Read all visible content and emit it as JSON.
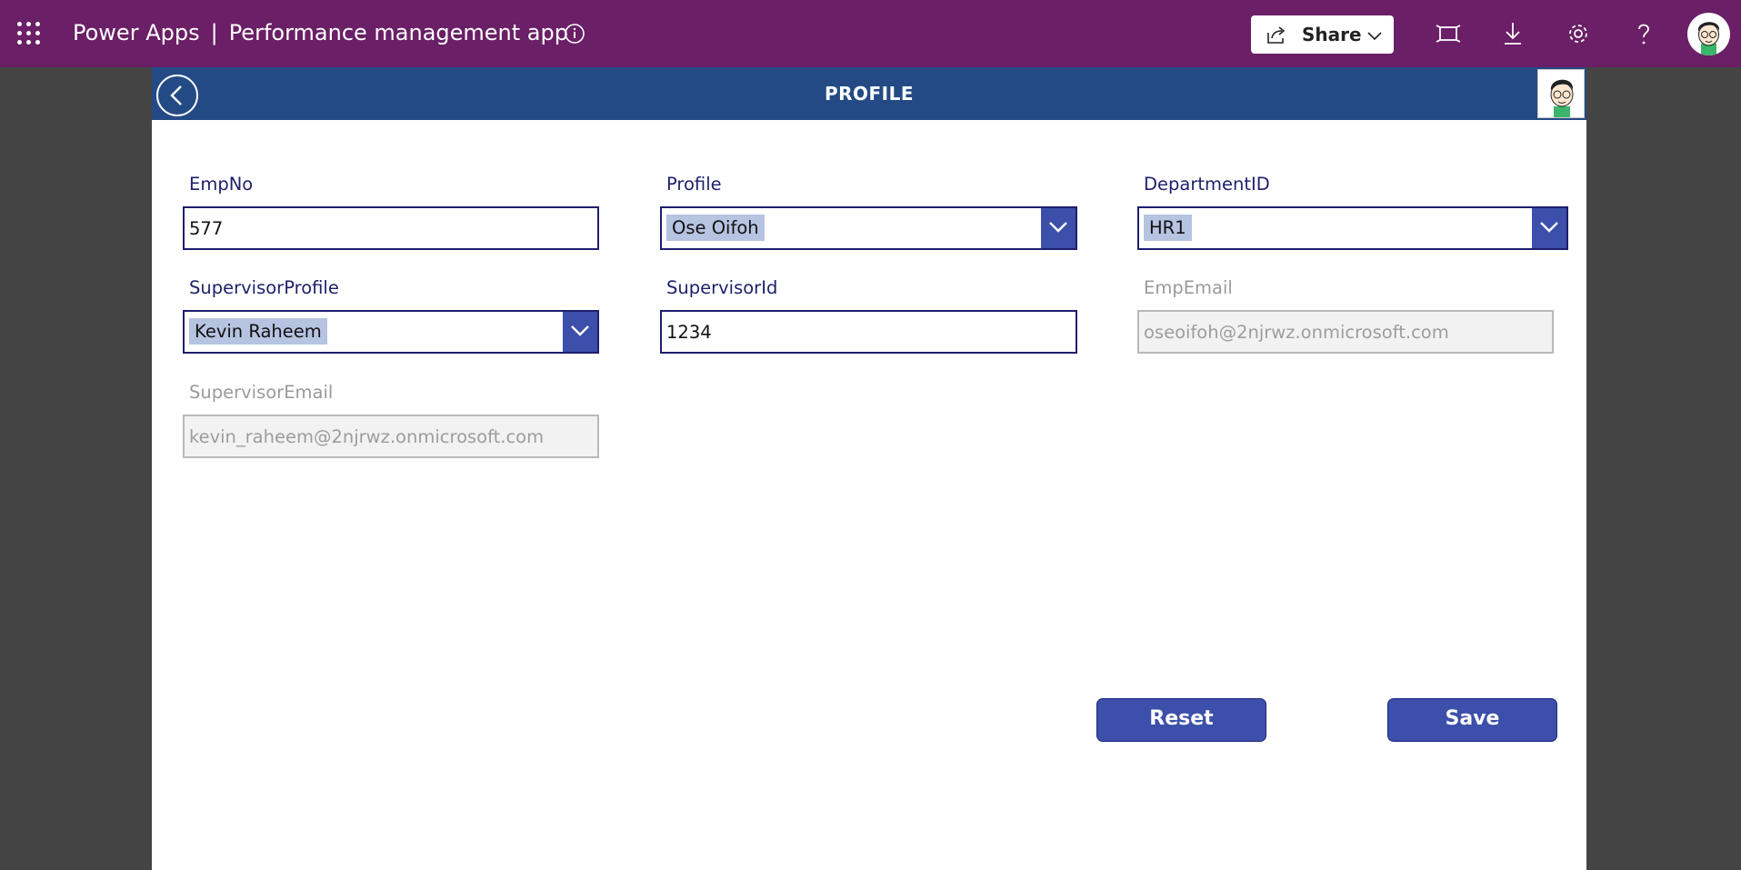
{
  "header": {
    "product": "Power Apps",
    "separator": "|",
    "app_name": "Performance management app",
    "icons": [
      "waffle-icon",
      "info-icon",
      "share-icon",
      "chevron-down-icon",
      "fit-to-screen-icon",
      "download-icon",
      "gear-icon",
      "help-icon",
      "avatar"
    ],
    "share_label": "Share",
    "color": "#6a1f66"
  },
  "app": {
    "title": "PROFILE",
    "header_color": "#234a85",
    "accent": "#3c4faa",
    "form": {
      "empno": {
        "label": "EmpNo",
        "value": "577"
      },
      "profile": {
        "label": "Profile",
        "value": "Ose Oifoh"
      },
      "department_id": {
        "label": "DepartmentID",
        "value": "HR1"
      },
      "supervisor_profile": {
        "label": "SupervisorProfile",
        "value": "Kevin Raheem"
      },
      "supervisor_id": {
        "label": "SupervisorId",
        "value": "1234"
      },
      "emp_email": {
        "label": "EmpEmail",
        "value": "oseoifoh@2njrwz.onmicrosoft.com"
      },
      "supervisor_email": {
        "label": "SupervisorEmail",
        "value": "kevin_raheem@2njrwz.onmicrosoft.com"
      }
    },
    "buttons": {
      "reset": "Reset",
      "save": "Save"
    }
  }
}
